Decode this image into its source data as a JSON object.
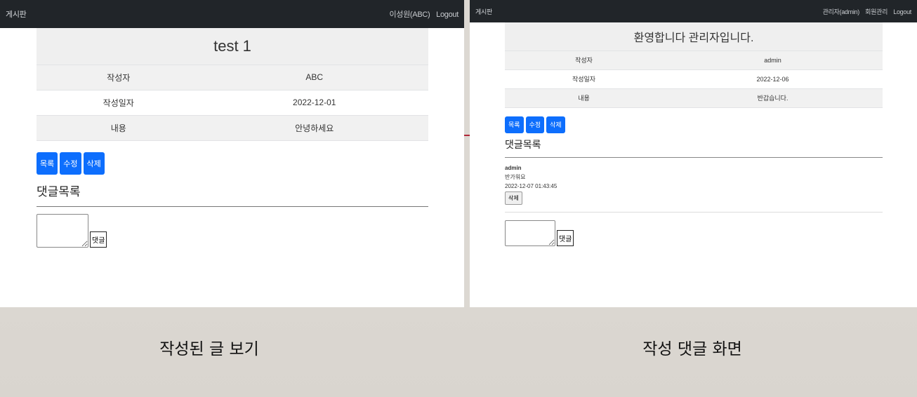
{
  "left": {
    "nav": {
      "brand": "게시판",
      "user": "이성원(ABC)",
      "logout": "Logout"
    },
    "post": {
      "title": "test 1",
      "rows": [
        {
          "label": "작성자",
          "value": "ABC"
        },
        {
          "label": "작성일자",
          "value": "2022-12-01"
        },
        {
          "label": "내용",
          "value": "안녕하세요"
        }
      ]
    },
    "buttons": {
      "list": "목록",
      "edit": "수정",
      "delete": "삭제"
    },
    "comments_heading": "댓글목록",
    "comment_submit": "댓글"
  },
  "right": {
    "nav": {
      "brand": "게시판",
      "user": "관리자(admin)",
      "members": "회원관리",
      "logout": "Logout"
    },
    "post": {
      "title": "환영합니다 관리자입니다.",
      "rows": [
        {
          "label": "작성자",
          "value": "admin"
        },
        {
          "label": "작성일자",
          "value": "2022-12-06"
        },
        {
          "label": "내용",
          "value": "반갑습니다."
        }
      ]
    },
    "buttons": {
      "list": "목록",
      "edit": "수정",
      "delete": "삭제"
    },
    "comments_heading": "댓글목록",
    "comments": [
      {
        "author": "admin",
        "text": "반가워요",
        "date": "2022-12-07 01:43:45",
        "delete_label": "삭제"
      }
    ],
    "comment_submit": "댓글"
  },
  "captions": {
    "left": "작성된 글 보기",
    "right": "작성 댓글 화면"
  },
  "colors": {
    "navbar": "#212529",
    "primary_button": "#0d6efd"
  }
}
